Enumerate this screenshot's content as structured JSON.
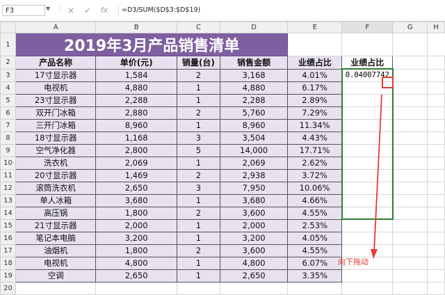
{
  "formula_bar": {
    "name_box": "F3",
    "formula": "=D3/SUM($D$3:$D$19)",
    "cancel_icon": "×",
    "enter_icon": "✓",
    "fx_label": "fx"
  },
  "columns": [
    "A",
    "B",
    "C",
    "D",
    "E",
    "F",
    "G",
    "H"
  ],
  "title": "2019年3月产品销售清单",
  "headers": [
    "产品名称",
    "单价(元)",
    "销量(台)",
    "销售金额",
    "业绩占比"
  ],
  "f_header": "业绩占比",
  "f3_value": "0.04007742",
  "rows": [
    {
      "num": "3",
      "name": "17寸显示器",
      "price": "1,584",
      "qty": "2",
      "amount": "3,168",
      "pct": "4.01%"
    },
    {
      "num": "4",
      "name": "电视机",
      "price": "4,880",
      "qty": "1",
      "amount": "4,880",
      "pct": "6.17%"
    },
    {
      "num": "5",
      "name": "23寸显示器",
      "price": "2,288",
      "qty": "1",
      "amount": "2,288",
      "pct": "2.89%"
    },
    {
      "num": "6",
      "name": "双开门冰箱",
      "price": "2,880",
      "qty": "2",
      "amount": "5,760",
      "pct": "7.29%"
    },
    {
      "num": "7",
      "name": "三开门冰箱",
      "price": "8,960",
      "qty": "1",
      "amount": "8,960",
      "pct": "11.34%"
    },
    {
      "num": "8",
      "name": "18寸显示器",
      "price": "1,168",
      "qty": "3",
      "amount": "3,504",
      "pct": "4.43%"
    },
    {
      "num": "9",
      "name": "空气净化器",
      "price": "2,800",
      "qty": "5",
      "amount": "14,000",
      "pct": "17.71%"
    },
    {
      "num": "10",
      "name": "洗衣机",
      "price": "2,069",
      "qty": "1",
      "amount": "2,069",
      "pct": "2.62%"
    },
    {
      "num": "11",
      "name": "20寸显示器",
      "price": "1,469",
      "qty": "2",
      "amount": "2,938",
      "pct": "3.72%"
    },
    {
      "num": "12",
      "name": "滚筒洗衣机",
      "price": "2,650",
      "qty": "3",
      "amount": "7,950",
      "pct": "10.06%"
    },
    {
      "num": "13",
      "name": "单人冰箱",
      "price": "3,680",
      "qty": "1",
      "amount": "3,680",
      "pct": "4.66%"
    },
    {
      "num": "14",
      "name": "高压锅",
      "price": "1,800",
      "qty": "2",
      "amount": "3,600",
      "pct": "4.55%"
    },
    {
      "num": "15",
      "name": "21寸显示器",
      "price": "2,000",
      "qty": "1",
      "amount": "2,000",
      "pct": "2.53%"
    },
    {
      "num": "16",
      "name": "笔记本电脑",
      "price": "3,200",
      "qty": "1",
      "amount": "3,200",
      "pct": "4.05%"
    },
    {
      "num": "17",
      "name": "油烟机",
      "price": "1,800",
      "qty": "2",
      "amount": "3,600",
      "pct": "4.55%"
    },
    {
      "num": "18",
      "name": "电视机",
      "price": "4,800",
      "qty": "1",
      "amount": "4,800",
      "pct": "6.07%"
    },
    {
      "num": "19",
      "name": "空调",
      "price": "2,650",
      "qty": "1",
      "amount": "2,650",
      "pct": "3.35%"
    }
  ],
  "extra_row_num": "20",
  "annotation": "向下拖动",
  "colors": {
    "title_bg": "#7e5fa0",
    "cell_bg": "#e7e1f0",
    "selection": "#2e7d32",
    "annotation": "#e53935"
  }
}
